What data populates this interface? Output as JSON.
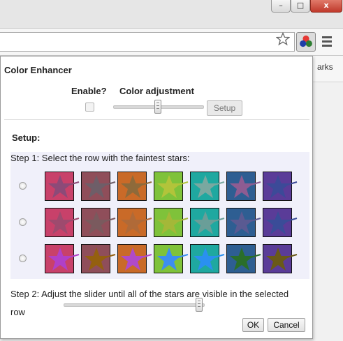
{
  "browser": {
    "bookmarks_peek": "arks",
    "window_controls": {
      "minimize_glyph": "–",
      "maximize_glyph": "□",
      "close_glyph": "x"
    }
  },
  "popup": {
    "title": "Color Enhancer",
    "enable_label": "Enable?",
    "color_adjustment_label": "Color adjustment",
    "enable_checked": false,
    "top_slider_level": 0.5,
    "setup_button": "Setup",
    "setup_heading": "Setup:",
    "step1": "Step 1: Select the row with the faintest stars:",
    "rows": [
      {
        "selected": false,
        "swatches": [
          {
            "bg": "#c8416a",
            "star": "#8c4a78"
          },
          {
            "bg": "#8f4e5a",
            "star": "#6e5e68"
          },
          {
            "bg": "#c96a28",
            "star": "#8e6a3a"
          },
          {
            "bg": "#7fc23a",
            "star": "#b2c43a"
          },
          {
            "bg": "#1fa8a0",
            "star": "#7aa8a0"
          },
          {
            "bg": "#2e5e92",
            "star": "#8e5c92"
          },
          {
            "bg": "#5a3c98",
            "star": "#3c4a98"
          }
        ]
      },
      {
        "selected": false,
        "swatches": [
          {
            "bg": "#c8416a",
            "star": "#9e4a6e"
          },
          {
            "bg": "#8f4e5a",
            "star": "#7a5a5e"
          },
          {
            "bg": "#c96a28",
            "star": "#b06a38"
          },
          {
            "bg": "#7fc23a",
            "star": "#a4b838"
          },
          {
            "bg": "#1fa8a0",
            "star": "#6a9e98"
          },
          {
            "bg": "#2e5e92",
            "star": "#5a5a92"
          },
          {
            "bg": "#5a3c98",
            "star": "#3a4c98"
          }
        ]
      },
      {
        "selected": false,
        "swatches": [
          {
            "bg": "#c8416a",
            "star": "#b040c8"
          },
          {
            "bg": "#8f4e5a",
            "star": "#946010"
          },
          {
            "bg": "#c96a28",
            "star": "#b04ac8"
          },
          {
            "bg": "#7fc23a",
            "star": "#3c8ef0"
          },
          {
            "bg": "#1fa8a0",
            "star": "#2a90f0"
          },
          {
            "bg": "#2e5e92",
            "star": "#2a6e2a"
          },
          {
            "bg": "#5a3c98",
            "star": "#6a5a18"
          }
        ]
      }
    ],
    "step2": "Step 2: Adjust the slider until all of the stars are visible in the selected row",
    "bottom_slider_level": 0.97,
    "ok_button": "OK",
    "cancel_button": "Cancel"
  },
  "icons": {
    "bookmark_star": "star-outline-icon",
    "extension": "color-enhancer-extension-icon",
    "menu": "hamburger-menu-icon"
  },
  "colors": {
    "setup_area_bg": "#f0f0fa",
    "ext_dot_red": "#e53935",
    "ext_dot_green": "#2e7d32",
    "ext_dot_blue": "#1e3ea8"
  }
}
